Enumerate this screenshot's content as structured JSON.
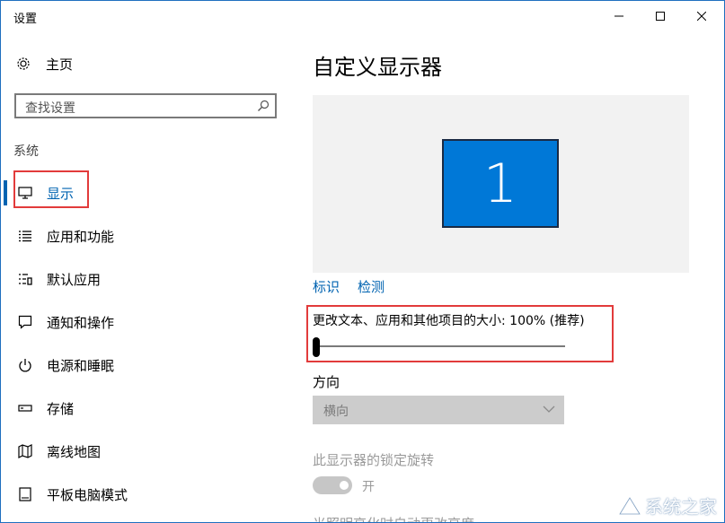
{
  "window": {
    "title": "设置"
  },
  "sidebar": {
    "home_label": "主页",
    "search_placeholder": "查找设置",
    "section_label": "系统",
    "items": [
      {
        "label": "显示",
        "icon": "monitor-icon",
        "active": true
      },
      {
        "label": "应用和功能",
        "icon": "list-icon"
      },
      {
        "label": "默认应用",
        "icon": "default-apps-icon"
      },
      {
        "label": "通知和操作",
        "icon": "notification-icon"
      },
      {
        "label": "电源和睡眠",
        "icon": "power-icon"
      },
      {
        "label": "存储",
        "icon": "storage-icon"
      },
      {
        "label": "离线地图",
        "icon": "map-icon"
      },
      {
        "label": "平板电脑模式",
        "icon": "tablet-icon"
      }
    ]
  },
  "main": {
    "title": "自定义显示器",
    "monitor_number": "1",
    "links": {
      "identify": "标识",
      "detect": "检测"
    },
    "scale": {
      "label": "更改文本、应用和其他项目的大小: 100% (推荐)",
      "value_percent": 100
    },
    "orientation": {
      "label": "方向",
      "value": "横向"
    },
    "rotation_lock": {
      "label": "此显示器的锁定旋转",
      "toggle_label": "开",
      "on": true
    },
    "cutoff_label": "光照明亮化时自动更改亮度"
  },
  "watermark": {
    "text": "系统之家"
  },
  "colors": {
    "accent": "#0063b1",
    "monitor_blue": "#0078d7",
    "highlight_red": "#e23b3b"
  }
}
